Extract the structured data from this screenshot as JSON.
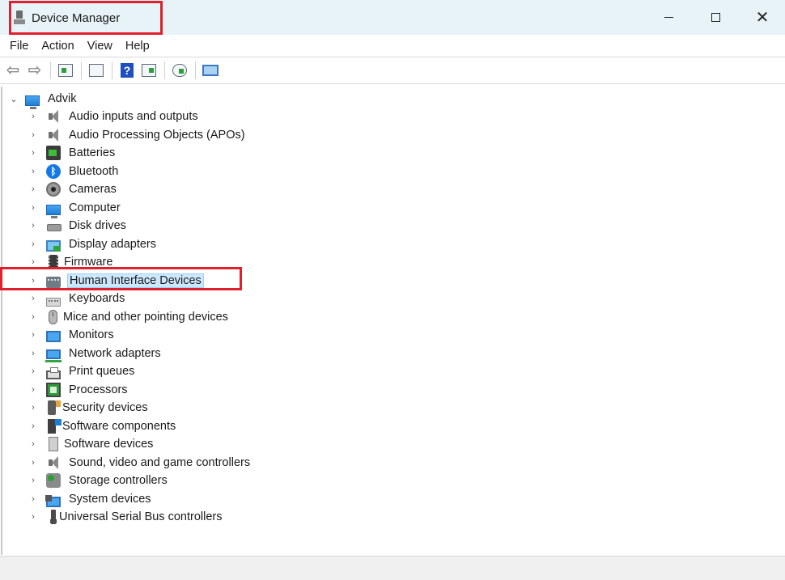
{
  "window": {
    "title": "Device Manager",
    "controls": {
      "minimize": "–",
      "maximize": "□",
      "close": "✕"
    }
  },
  "menu": [
    "File",
    "Action",
    "View",
    "Help"
  ],
  "toolbar": {
    "icons": [
      "back-arrow-icon",
      "forward-arrow-icon",
      "show-hide-console-tree-icon",
      "properties-icon",
      "help-icon",
      "action-pane-icon",
      "update-driver-icon",
      "scan-hardware-icon"
    ]
  },
  "tree": {
    "root": "Advik",
    "selected": "Human Interface Devices",
    "categories": [
      {
        "label": "Audio inputs and outputs",
        "icon": "speaker-icon"
      },
      {
        "label": "Audio Processing Objects (APOs)",
        "icon": "speaker-icon"
      },
      {
        "label": "Batteries",
        "icon": "battery-icon"
      },
      {
        "label": "Bluetooth",
        "icon": "bluetooth-icon"
      },
      {
        "label": "Cameras",
        "icon": "camera-icon"
      },
      {
        "label": "Computer",
        "icon": "computer-icon"
      },
      {
        "label": "Disk drives",
        "icon": "disk-drive-icon"
      },
      {
        "label": "Display adapters",
        "icon": "display-adapter-icon"
      },
      {
        "label": "Firmware",
        "icon": "firmware-chip-icon"
      },
      {
        "label": "Human Interface Devices",
        "icon": "hid-icon"
      },
      {
        "label": "Keyboards",
        "icon": "keyboard-icon"
      },
      {
        "label": "Mice and other pointing devices",
        "icon": "mouse-icon"
      },
      {
        "label": "Monitors",
        "icon": "monitor-icon"
      },
      {
        "label": "Network adapters",
        "icon": "network-adapter-icon"
      },
      {
        "label": "Print queues",
        "icon": "printer-icon"
      },
      {
        "label": "Processors",
        "icon": "processor-icon"
      },
      {
        "label": "Security devices",
        "icon": "security-device-icon"
      },
      {
        "label": "Software components",
        "icon": "software-component-icon"
      },
      {
        "label": "Software devices",
        "icon": "software-device-icon"
      },
      {
        "label": "Sound, video and game controllers",
        "icon": "speaker-icon"
      },
      {
        "label": "Storage controllers",
        "icon": "storage-controller-icon"
      },
      {
        "label": "System devices",
        "icon": "system-device-icon"
      },
      {
        "label": "Universal Serial Bus controllers",
        "icon": "usb-icon"
      }
    ]
  }
}
